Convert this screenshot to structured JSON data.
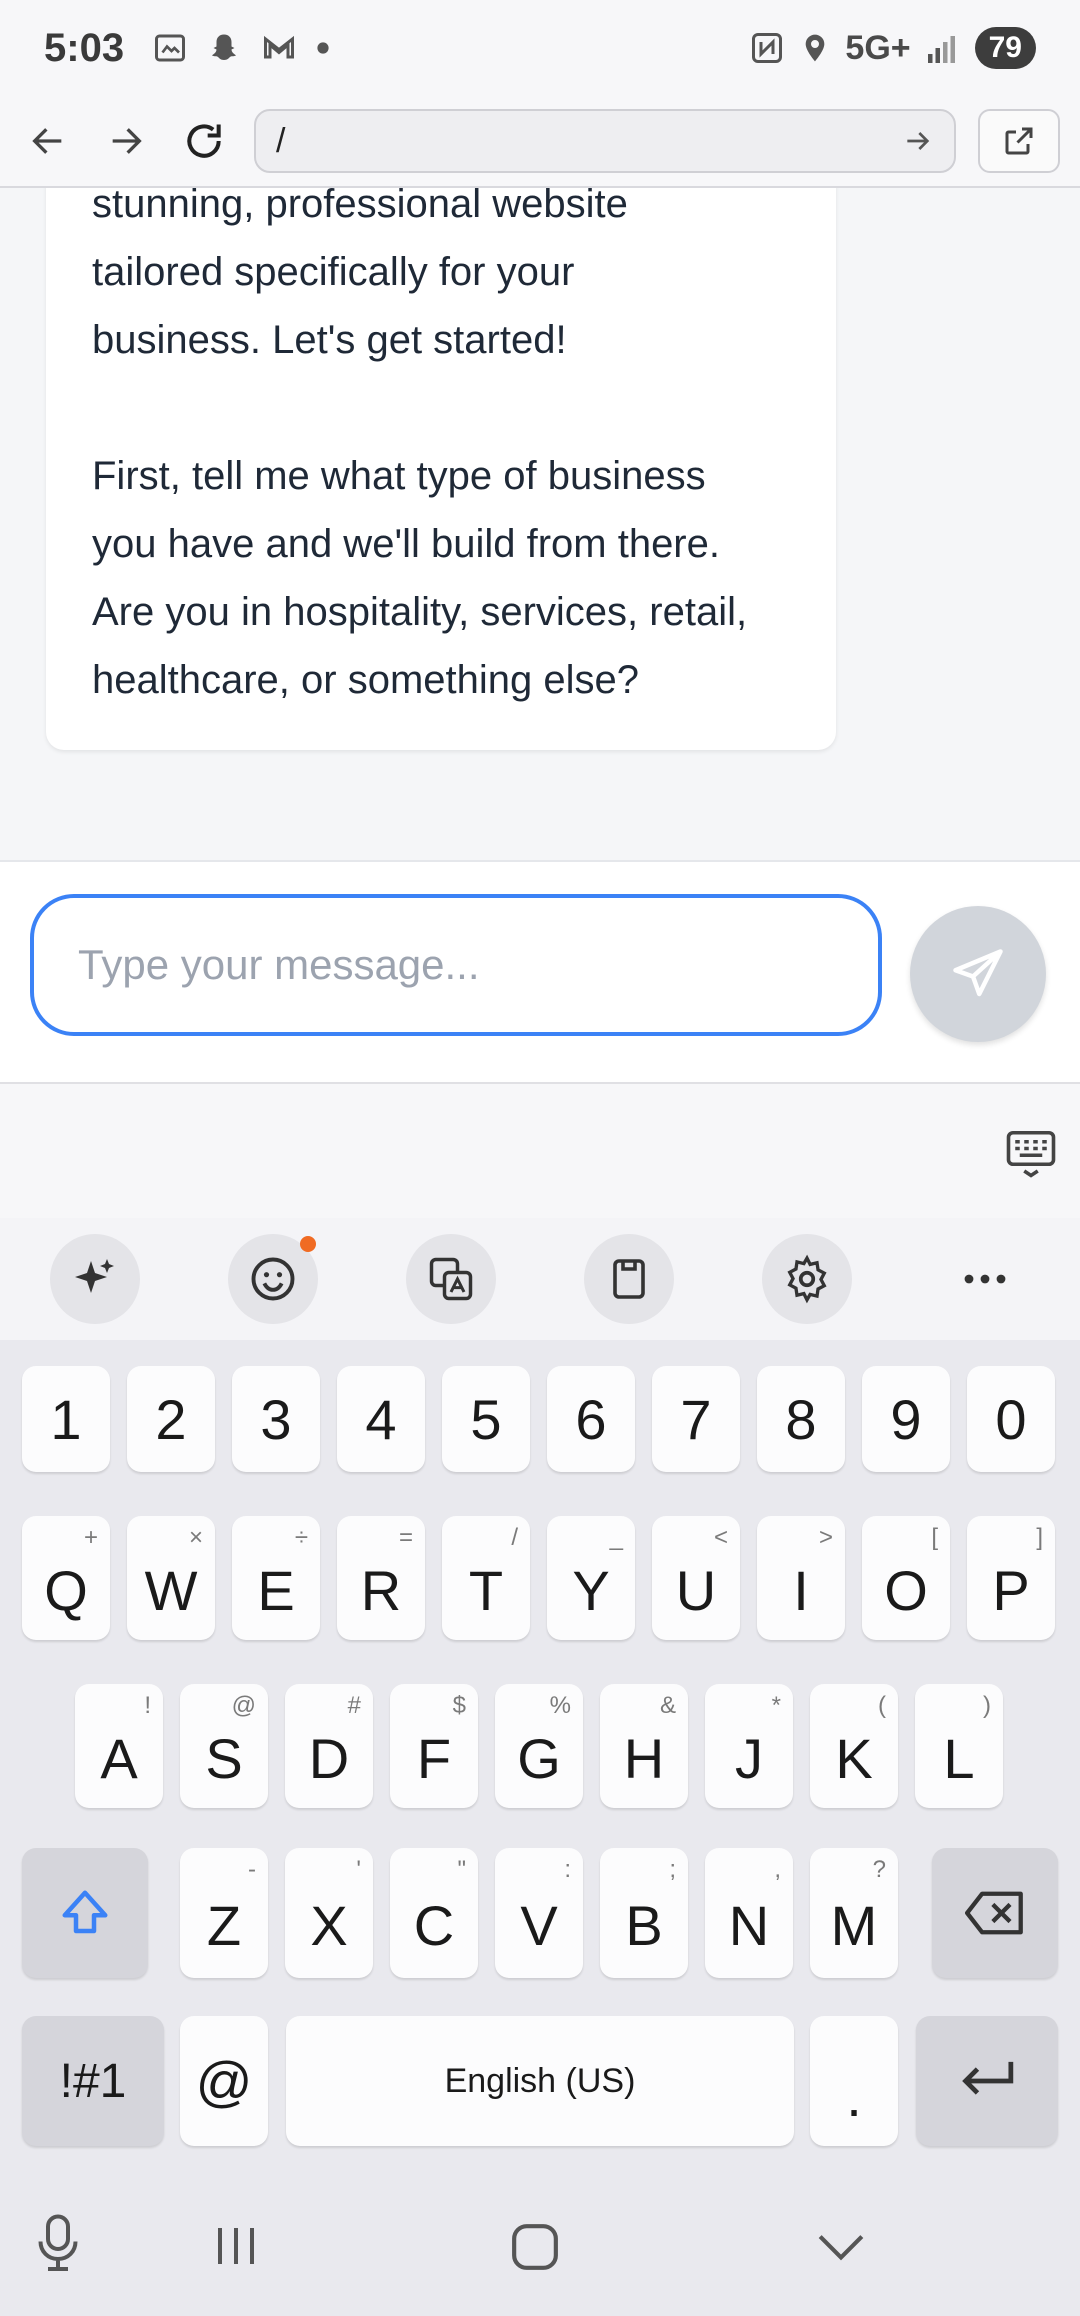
{
  "status": {
    "time": "5:03",
    "network": "5G+",
    "battery": "79"
  },
  "browser": {
    "url": "/"
  },
  "chat": {
    "bot_message": "stunning, professional website\ntailored specifically for your\nbusiness. Let's get started!\n\nFirst, tell me what type of business\nyou have and we'll build from there.\nAre you in hospitality, services, retail,\nhealthcare, or something else?"
  },
  "input": {
    "placeholder": "Type your message...",
    "value": ""
  },
  "keyboard": {
    "numbers": [
      "1",
      "2",
      "3",
      "4",
      "5",
      "6",
      "7",
      "8",
      "9",
      "0"
    ],
    "row1": [
      {
        "key": "Q",
        "sub": "+"
      },
      {
        "key": "W",
        "sub": "×"
      },
      {
        "key": "E",
        "sub": "÷"
      },
      {
        "key": "R",
        "sub": "="
      },
      {
        "key": "T",
        "sub": "/"
      },
      {
        "key": "Y",
        "sub": "_"
      },
      {
        "key": "U",
        "sub": "<"
      },
      {
        "key": "I",
        "sub": ">"
      },
      {
        "key": "O",
        "sub": "["
      },
      {
        "key": "P",
        "sub": "]"
      }
    ],
    "row2": [
      {
        "key": "A",
        "sub": "!"
      },
      {
        "key": "S",
        "sub": "@"
      },
      {
        "key": "D",
        "sub": "#"
      },
      {
        "key": "F",
        "sub": "$"
      },
      {
        "key": "G",
        "sub": "%"
      },
      {
        "key": "H",
        "sub": "&"
      },
      {
        "key": "J",
        "sub": "*"
      },
      {
        "key": "K",
        "sub": "("
      },
      {
        "key": "L",
        "sub": ")"
      }
    ],
    "row3": [
      {
        "key": "Z",
        "sub": "-"
      },
      {
        "key": "X",
        "sub": "'"
      },
      {
        "key": "C",
        "sub": "\""
      },
      {
        "key": "V",
        "sub": ":"
      },
      {
        "key": "B",
        "sub": ";"
      },
      {
        "key": "N",
        "sub": ","
      },
      {
        "key": "M",
        "sub": "?"
      }
    ],
    "symbols_label": "!#1",
    "at_label": "@",
    "space_label": "English (US)",
    "period_label": ".",
    "accent_color": "#3b82f6"
  }
}
